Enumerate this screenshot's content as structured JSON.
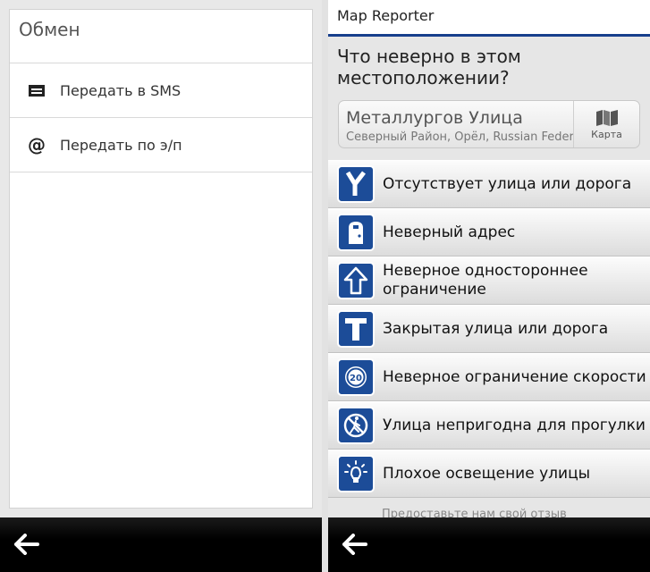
{
  "left": {
    "title": "Обмен",
    "items": [
      {
        "label": "Передать в SMS",
        "icon": "sms-icon"
      },
      {
        "label": "Передать по э/п",
        "icon": "email-icon"
      }
    ]
  },
  "right": {
    "app_title": "Map Reporter",
    "question": "Что неверно в этом местоположении?",
    "location": {
      "street": "Металлургов Улица",
      "region": "Северный Район, Орёл, Russian Federation",
      "map_button": "Карта"
    },
    "issues": [
      {
        "label": "Отсутствует улица или дорога",
        "icon": "missing-road-icon"
      },
      {
        "label": "Неверный адрес",
        "icon": "wrong-address-icon"
      },
      {
        "label": "Неверное одностороннее ограничение",
        "icon": "one-way-icon"
      },
      {
        "label": "Закрытая улица или дорога",
        "icon": "closed-road-icon"
      },
      {
        "label": "Неверное ограничение скорости",
        "icon": "speed-limit-icon",
        "badge": "20"
      },
      {
        "label": "Улица непригодна для прогулки",
        "icon": "no-walking-icon"
      },
      {
        "label": "Плохое освещение улицы",
        "icon": "street-light-icon"
      }
    ],
    "footer_hint": "Предоставьте нам свой отзыв"
  },
  "colors": {
    "accent": "#173f8c",
    "icon_blue": "#1c4c98",
    "toolbar": "#000000"
  }
}
